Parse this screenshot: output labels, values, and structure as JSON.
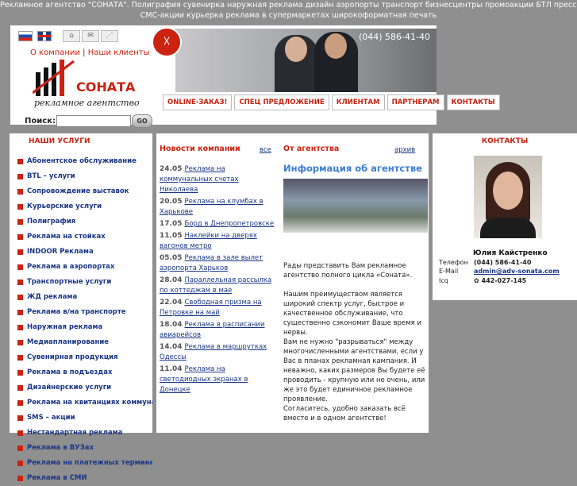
{
  "topbar": {
    "line1": "Рекламное агентство \"СОНАТА\". Полиграфия сувенирка наружная реклама дизайн аэропорты транспорт бизнесцентры промоакции БТЛ пресса нестандарт",
    "line2": "СМС-акции курьерка реклама в супермаркетах широкоформатная печать"
  },
  "header": {
    "phone": "(044) 586-41-40",
    "links": {
      "about": "О компании",
      "clients": "Наши клиенты"
    },
    "logo_text": "СОНАТА",
    "slogan": "рекламное агентство"
  },
  "menu": [
    "ONLINE-ЗАКАЗ!",
    "СПЕЦ ПРЕДЛОЖЕНИЕ",
    "КЛИЕНТАМ",
    "ПАРТНЕРАМ",
    "КОНТАКТЫ"
  ],
  "search": {
    "label": "Поиск:",
    "button": "GO",
    "value": ""
  },
  "services": {
    "title": "НАШИ УСЛУГИ",
    "items": [
      "Абонентское обслуживание",
      "BTL – услуги",
      "Сопровождение выставок",
      "Курьерские услуги",
      "Полиграфия",
      "Реклама на стойках",
      "INDOOR Реклама",
      "Реклама в аэропортах",
      "Транспортные услуги",
      "ЖД реклама",
      "Реклама в/на транспорте",
      "Наружная реклама",
      "Медиапланирование",
      "Сувенирная продукция",
      "Реклама в подъездах",
      "Дизайнерские услуги",
      "Реклама на квитанциях коммунальных",
      "SMS – акции",
      "Нестандартная реклама",
      "Реклама в ВУЗах",
      "Реклама на платежных терминалах",
      "Реклама в СМИ"
    ]
  },
  "news": {
    "title": "Новости компании",
    "all_link": "все",
    "items": [
      {
        "date": "24.05",
        "text": "Реклама на коммунальных счетах Николаева"
      },
      {
        "date": "20.05",
        "text": "Реклама на клумбах в Харькове"
      },
      {
        "date": "17.05",
        "text": "Борд в Днепропетровске"
      },
      {
        "date": "11.05",
        "text": "Наклейки на дверях вагонов метро"
      },
      {
        "date": "05.05",
        "text": "Реклама в зале вылет аэропорта Харьков"
      },
      {
        "date": "28.04",
        "text": "Параллельная рассылка по коттеджам в мае"
      },
      {
        "date": "22.04",
        "text": "Свободная призма на Петровке на май"
      },
      {
        "date": "18.04",
        "text": "Реклама в расписании авиарейсов"
      },
      {
        "date": "14.04",
        "text": "Реклама в маршрутках Одессы"
      },
      {
        "date": "11.04",
        "text": "Реклама на светодиодных экранах в Донецке"
      }
    ]
  },
  "agency": {
    "title": "От агентства",
    "archive_link": "архив",
    "info_title": "Информация об агентстве",
    "text": "Рады представить Вам рекламное агентство полного цикла «Соната».\n\nНашим преимуществом является широкий спектр услуг, быстрое и качественное обслуживание, что существенно сэкономит Ваше время и нервы.\nВам не нужно \"разрываться\" между многочисленными агентствами, если у Вас в планах рекламная кампания. И неважно, каких размеров Вы будете её проводить - крупную или не очень, или же это будет единичное рекламное проявление.\nСогласитесь, удобно заказать всё вместе и в одном агентстве!"
  },
  "contacts": {
    "title": "КОНТАКТЫ",
    "name": "Юлия Кайстренко",
    "phone_label": "Телефон",
    "phone": "(044) 586-41-40",
    "email_label": "E-Mail",
    "email": "admin@adv-sonata.com",
    "icq_label": "Icq",
    "icq": "442-027-145"
  }
}
